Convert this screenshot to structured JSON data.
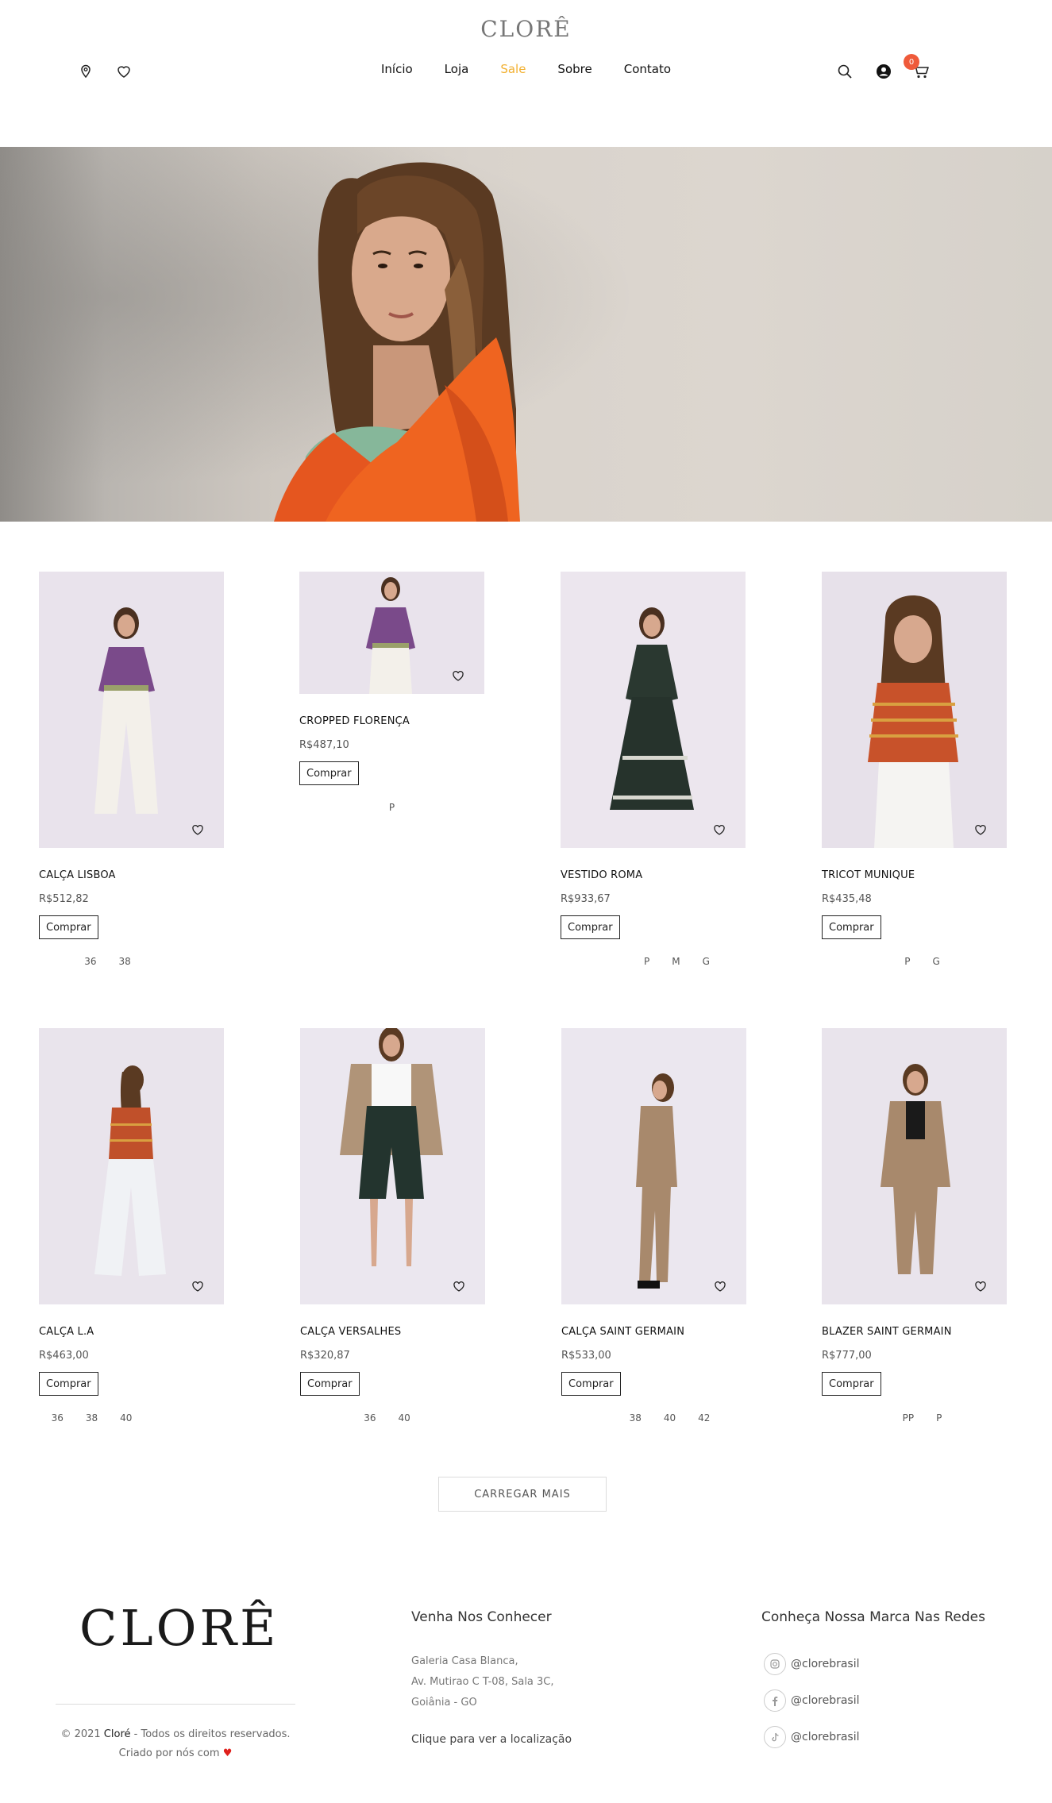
{
  "header": {
    "logo": "CLORÊ",
    "nav": [
      "Início",
      "Loja",
      "Sale",
      "Sobre",
      "Contato"
    ],
    "active_nav": "Sale",
    "cart_count": "0",
    "accent_color": "#f2b030",
    "badge_color": "#ef5a3a"
  },
  "icons": {
    "left": [
      "map-pin-icon",
      "heart-icon"
    ],
    "right": [
      "search-icon",
      "user-icon",
      "cart-icon"
    ]
  },
  "products": [
    {
      "name": "CALÇA LISBOA",
      "price": "R$512,82",
      "buy": "Comprar",
      "sizes": [
        "36",
        "38"
      ]
    },
    {
      "name": "CROPPED FLORENÇA",
      "price": "R$487,10",
      "buy": "Comprar",
      "sizes": [
        "P"
      ]
    },
    {
      "name": "VESTIDO ROMA",
      "price": "R$933,67",
      "buy": "Comprar",
      "sizes": [
        "P",
        "M",
        "G"
      ]
    },
    {
      "name": "TRICOT MUNIQUE",
      "price": "R$435,48",
      "buy": "Comprar",
      "sizes": [
        "P",
        "G"
      ]
    },
    {
      "name": "CALÇA L.A",
      "price": "R$463,00",
      "buy": "Comprar",
      "sizes": [
        "36",
        "38",
        "40"
      ]
    },
    {
      "name": "CALÇA VERSALHES",
      "price": "R$320,87",
      "buy": "Comprar",
      "sizes": [
        "36",
        "40"
      ]
    },
    {
      "name": "CALÇA SAINT GERMAIN",
      "price": "R$533,00",
      "buy": "Comprar",
      "sizes": [
        "38",
        "40",
        "42"
      ]
    },
    {
      "name": "BLAZER SAINT GERMAIN",
      "price": "R$777,00",
      "buy": "Comprar",
      "sizes": [
        "PP",
        "P"
      ]
    }
  ],
  "load_more": "CARREGAR MAIS",
  "footer": {
    "logo": "CLORÊ",
    "copyright_pre": "© 2021 ",
    "copyright_brand": "Cloré",
    "copyright_post": " - Todos os direitos reservados.",
    "created_by": "Criado por nós com",
    "heart": "♥",
    "visit_heading": "Venha Nos Conhecer",
    "address": [
      "Galeria Casa Blanca,",
      "Av. Mutirao C T-08, Sala 3C,",
      "Goiânia - GO"
    ],
    "location_link": "Clique para ver a localização",
    "social_heading": "Conheça Nossa Marca Nas Redes",
    "socials": [
      {
        "icon": "instagram-icon",
        "handle": "@clorebrasil"
      },
      {
        "icon": "facebook-icon",
        "handle": "@clorebrasil"
      },
      {
        "icon": "tiktok-icon",
        "handle": "@clorebrasil"
      }
    ]
  }
}
